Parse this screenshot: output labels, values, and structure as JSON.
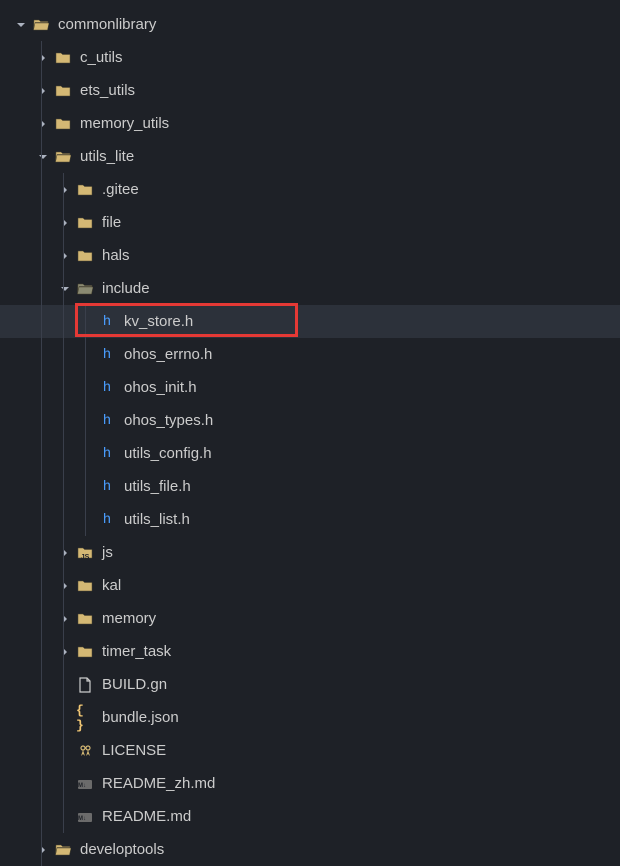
{
  "tree": [
    {
      "indent": 0,
      "chevron": "down",
      "icon": "folder-open",
      "label": "commonlibrary"
    },
    {
      "indent": 1,
      "chevron": "right",
      "icon": "folder",
      "label": "c_utils"
    },
    {
      "indent": 1,
      "chevron": "right",
      "icon": "folder",
      "label": "ets_utils"
    },
    {
      "indent": 1,
      "chevron": "right",
      "icon": "folder",
      "label": "memory_utils"
    },
    {
      "indent": 1,
      "chevron": "down",
      "icon": "folder-open",
      "label": "utils_lite"
    },
    {
      "indent": 2,
      "chevron": "right",
      "icon": "folder",
      "label": ".gitee"
    },
    {
      "indent": 2,
      "chevron": "right",
      "icon": "folder",
      "label": "file"
    },
    {
      "indent": 2,
      "chevron": "right",
      "icon": "folder",
      "label": "hals"
    },
    {
      "indent": 2,
      "chevron": "down",
      "icon": "folder-open-dim",
      "label": "include"
    },
    {
      "indent": 3,
      "chevron": "none",
      "icon": "h-file",
      "label": "kv_store.h",
      "selected": true,
      "highlighted": true
    },
    {
      "indent": 3,
      "chevron": "none",
      "icon": "h-file",
      "label": "ohos_errno.h"
    },
    {
      "indent": 3,
      "chevron": "none",
      "icon": "h-file",
      "label": "ohos_init.h"
    },
    {
      "indent": 3,
      "chevron": "none",
      "icon": "h-file",
      "label": "ohos_types.h"
    },
    {
      "indent": 3,
      "chevron": "none",
      "icon": "h-file",
      "label": "utils_config.h"
    },
    {
      "indent": 3,
      "chevron": "none",
      "icon": "h-file",
      "label": "utils_file.h"
    },
    {
      "indent": 3,
      "chevron": "none",
      "icon": "h-file",
      "label": "utils_list.h"
    },
    {
      "indent": 2,
      "chevron": "right",
      "icon": "folder-js",
      "label": "js"
    },
    {
      "indent": 2,
      "chevron": "right",
      "icon": "folder",
      "label": "kal"
    },
    {
      "indent": 2,
      "chevron": "right",
      "icon": "folder",
      "label": "memory"
    },
    {
      "indent": 2,
      "chevron": "right",
      "icon": "folder",
      "label": "timer_task"
    },
    {
      "indent": 2,
      "chevron": "none",
      "icon": "file",
      "label": "BUILD.gn"
    },
    {
      "indent": 2,
      "chevron": "none",
      "icon": "json",
      "label": "bundle.json"
    },
    {
      "indent": 2,
      "chevron": "none",
      "icon": "license",
      "label": "LICENSE"
    },
    {
      "indent": 2,
      "chevron": "none",
      "icon": "markdown",
      "label": "README_zh.md"
    },
    {
      "indent": 2,
      "chevron": "none",
      "icon": "markdown",
      "label": "README.md"
    },
    {
      "indent": 1,
      "chevron": "right",
      "icon": "folder-open-partial",
      "label": "developtools"
    }
  ],
  "indentUnit": 22,
  "baseIndent": 14
}
